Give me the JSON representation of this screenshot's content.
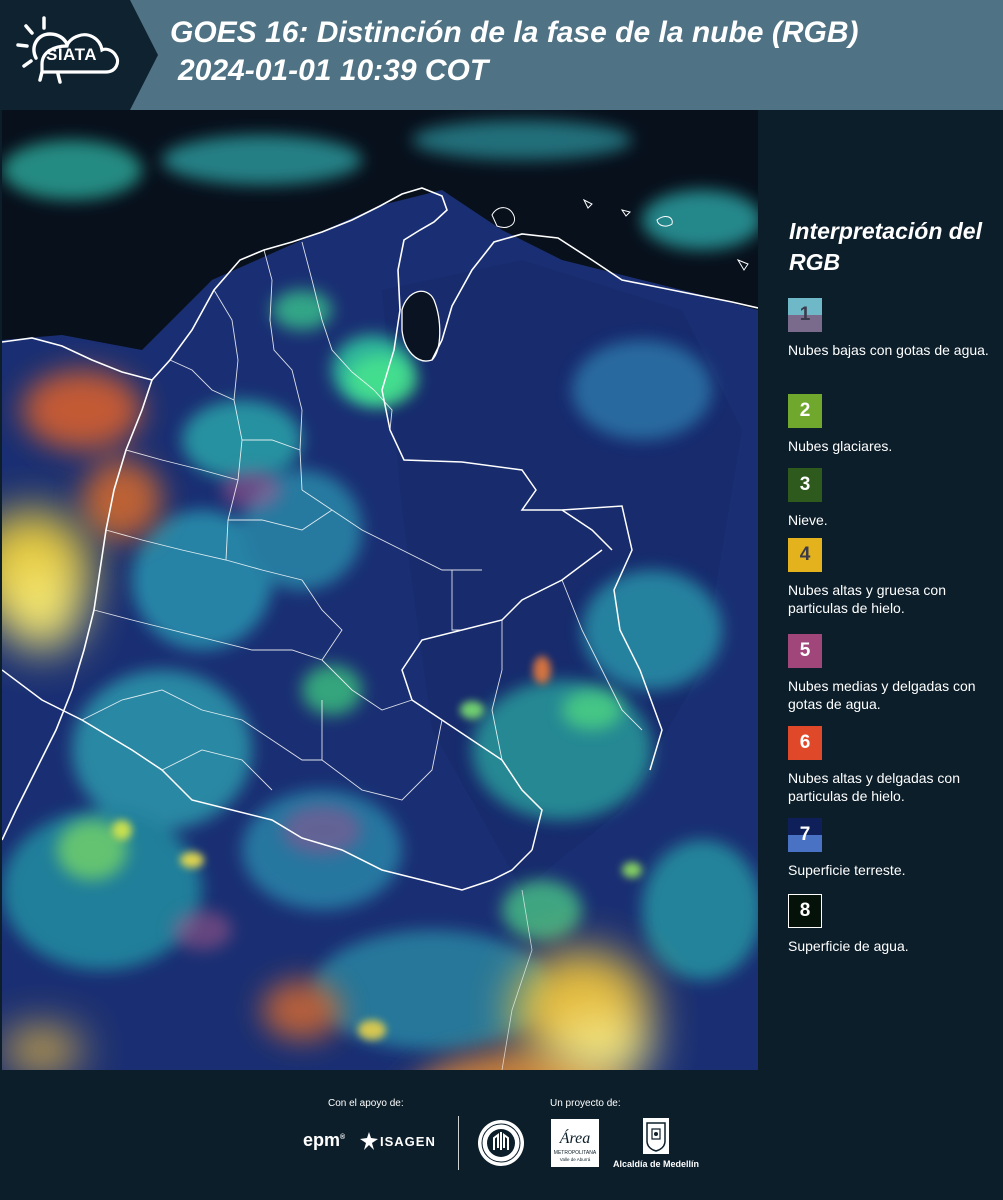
{
  "header": {
    "logo_text": "SIATA",
    "title_line1": "GOES 16: Distinción de la fase de la nube (RGB)",
    "title_line2": "2024-01-01 10:39 COT"
  },
  "legend": {
    "title": "Interpretación del RGB",
    "items": [
      {
        "number": "1",
        "label": "Nubes bajas con gotas de agua.",
        "color_top": "#6eb8c8",
        "color_bottom": "#7a6a8c",
        "text_color": "#3a3a4a"
      },
      {
        "number": "2",
        "label": "Nubes glaciares.",
        "color": "#6fa82c",
        "text_color": "#ffffff"
      },
      {
        "number": "3",
        "label": "Nieve.",
        "color": "#2e5a1e",
        "text_color": "#ffffff"
      },
      {
        "number": "4",
        "label": "Nubes altas y gruesa con particulas de hielo.",
        "color": "#e3b21c",
        "text_color": "#3a3a4a"
      },
      {
        "number": "5",
        "label": "Nubes medias y delgadas con gotas de agua.",
        "color": "#a0467a",
        "text_color": "#ffffff"
      },
      {
        "number": "6",
        "label": "Nubes altas y delgadas con particulas de hielo.",
        "color": "#e0482a",
        "text_color": "#ffffff"
      },
      {
        "number": "7",
        "label": "Superficie terreste.",
        "color_top": "#0e1f5a",
        "color_bottom": "#4a72c4",
        "text_color": "#ffffff"
      },
      {
        "number": "8",
        "label": "Superficie de agua.",
        "color": "#05120a",
        "text_color": "#ffffff",
        "border": "#ffffff"
      }
    ]
  },
  "footer": {
    "support_label": "Con el apoyo de:",
    "project_label": "Un proyecto de:",
    "epm": "epm",
    "isagen": "ISAGEN",
    "area_title": "Área",
    "area_sub1": "METROPOLITANA",
    "area_sub2": "Valle de Aburrá",
    "alcaldia": "Alcaldía de Medellín"
  },
  "colors": {
    "header_bg": "#4f7384",
    "logo_bg": "#0e2230",
    "page_bg": "#0c1e2a",
    "map_ocean": "#08101c",
    "map_land": "#1a2f73",
    "boundary": "#ffffff"
  }
}
